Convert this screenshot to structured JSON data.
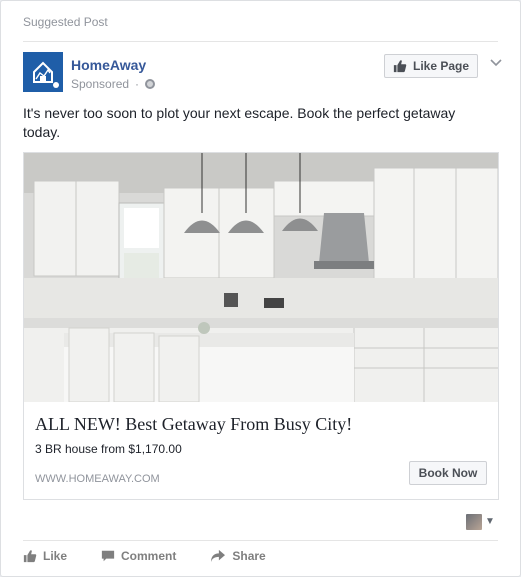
{
  "header": {
    "suggested_label": "Suggested Post"
  },
  "post": {
    "page_name": "HomeAway",
    "sponsored_label": "Sponsored",
    "privacy_separator": "·",
    "like_page_label": "Like Page",
    "body_text": "It's never too soon to plot your next escape. Book the perfect getaway today."
  },
  "ad": {
    "headline": "ALL NEW! Best Getaway From Busy City!",
    "subtitle": "3 BR house from $1,170.00",
    "url_display": "WWW.HOMEAWAY.COM",
    "cta_label": "Book Now"
  },
  "footer": {
    "actions": [
      {
        "label": "Like",
        "icon": "like-icon"
      },
      {
        "label": "Comment",
        "icon": "comment-icon"
      },
      {
        "label": "Share",
        "icon": "share-icon"
      }
    ]
  },
  "colors": {
    "brand_blue": "#365899",
    "avatar_blue": "#1f5ea8",
    "muted_text": "#90949c",
    "body_text": "#1d2129"
  }
}
